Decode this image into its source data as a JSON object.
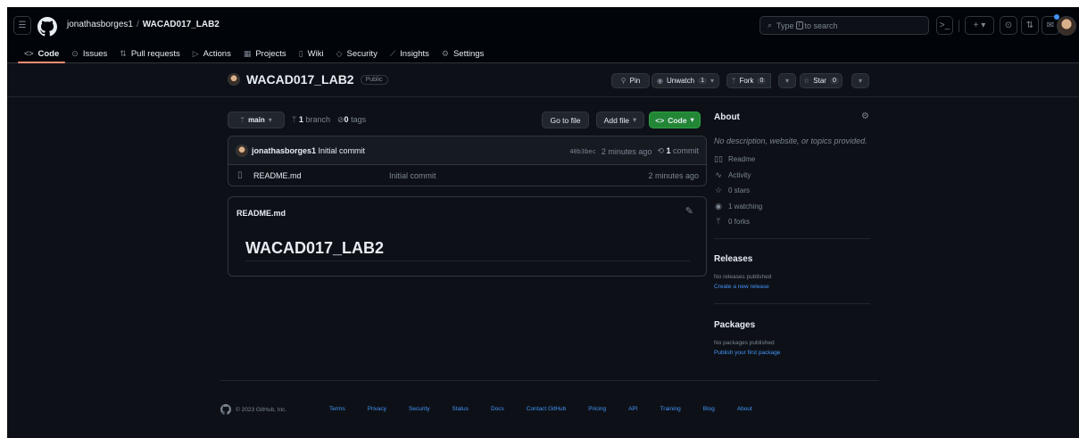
{
  "header": {
    "owner": "jonathasborges1",
    "separator": "/",
    "repo": "WACAD017_LAB2",
    "search": {
      "prefix": "Type",
      "key": "/",
      "suffix": "to search"
    }
  },
  "nav": [
    {
      "icon": "code-icon",
      "glyph": "<>",
      "label": "Code",
      "active": true
    },
    {
      "icon": "issue-icon",
      "glyph": "⊙",
      "label": "Issues"
    },
    {
      "icon": "pull-request-icon",
      "glyph": "⇅",
      "label": "Pull requests"
    },
    {
      "icon": "actions-icon",
      "glyph": "▷",
      "label": "Actions"
    },
    {
      "icon": "projects-icon",
      "glyph": "▦",
      "label": "Projects"
    },
    {
      "icon": "wiki-icon",
      "glyph": "▯",
      "label": "Wiki"
    },
    {
      "icon": "security-icon",
      "glyph": "◇",
      "label": "Security"
    },
    {
      "icon": "insights-icon",
      "glyph": "⟋",
      "label": "Insights"
    },
    {
      "icon": "settings-icon",
      "glyph": "⚙",
      "label": "Settings"
    }
  ],
  "repo": {
    "name": "WACAD017_LAB2",
    "visibility": "Public",
    "pin_label": "Pin",
    "unwatch_label": "Unwatch",
    "unwatch_count": "1",
    "fork_label": "Fork",
    "fork_count": "0",
    "star_label": "Star",
    "star_count": "0"
  },
  "toolbar": {
    "branch": "main",
    "branches_count": "1",
    "branches_label": "branch",
    "tags_count": "0",
    "tags_label": "tags",
    "goto_file": "Go to file",
    "add_file": "Add file",
    "code": "Code"
  },
  "commit": {
    "author": "jonathasborges1",
    "message": "Initial commit",
    "sha": "40b3bec",
    "time": "2 minutes ago",
    "commits_count": "1",
    "commits_label": "commit"
  },
  "files": [
    {
      "name": "README.md",
      "message": "Initial commit",
      "date": "2 minutes ago"
    }
  ],
  "readme": {
    "label": "README.md",
    "heading": "WACAD017_LAB2"
  },
  "sidebar": {
    "about_title": "About",
    "description": "No description, website, or topics provided.",
    "items": [
      {
        "icon": "book-icon",
        "glyph": "▯▯",
        "label": "Readme"
      },
      {
        "icon": "pulse-icon",
        "glyph": "∿",
        "label": "Activity"
      },
      {
        "icon": "star-icon",
        "glyph": "☆",
        "label": "0 stars"
      },
      {
        "icon": "eye-icon",
        "glyph": "◉",
        "label": "1 watching"
      },
      {
        "icon": "fork-icon",
        "glyph": "ᛘ",
        "label": "0 forks"
      }
    ],
    "releases_title": "Releases",
    "releases_none": "No releases published",
    "releases_link": "Create a new release",
    "packages_title": "Packages",
    "packages_none": "No packages published",
    "packages_link": "Publish your first package"
  },
  "footer": {
    "copyright": "© 2023 GitHub, Inc.",
    "links": [
      "Terms",
      "Privacy",
      "Security",
      "Status",
      "Docs",
      "Contact GitHub",
      "Pricing",
      "API",
      "Training",
      "Blog",
      "About"
    ]
  }
}
